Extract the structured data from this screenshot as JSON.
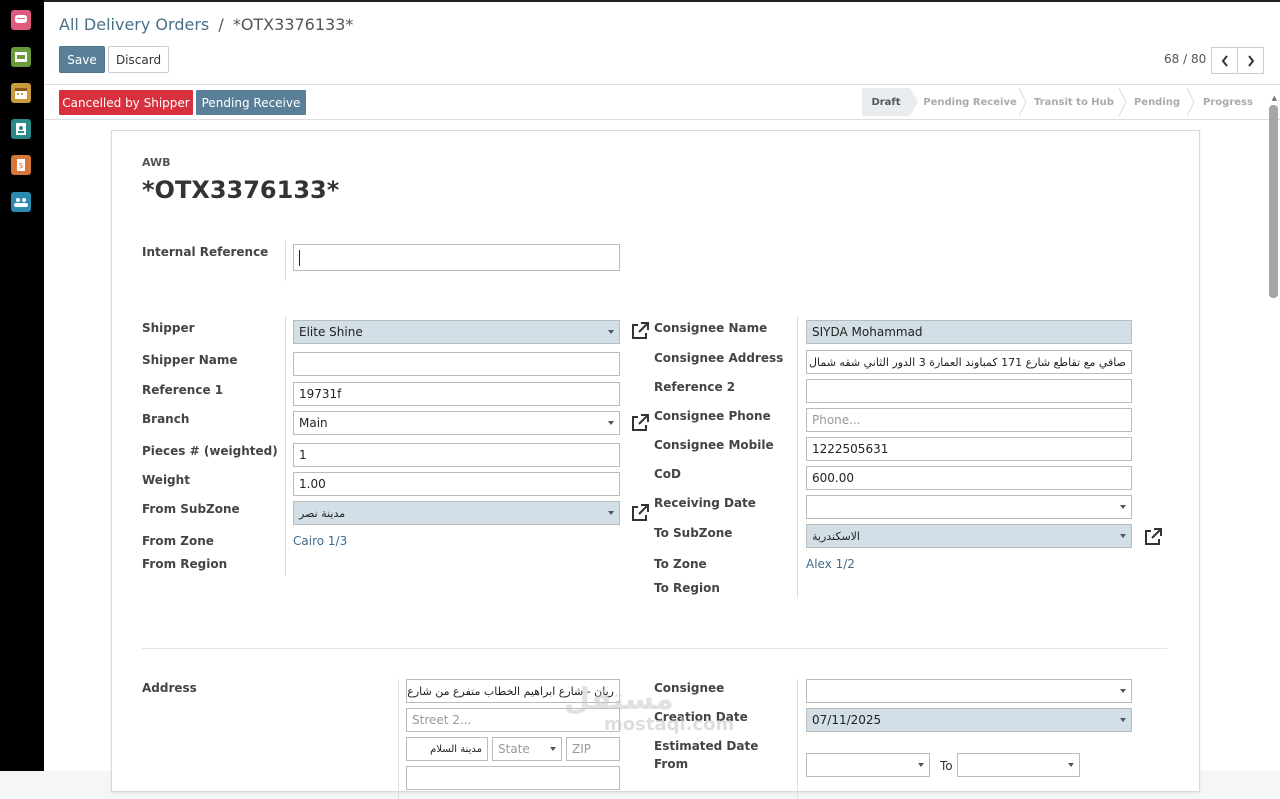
{
  "sidebar": {
    "apps": [
      {
        "icon": "discuss-icon",
        "color": "#e05c7f"
      },
      {
        "icon": "inventory-icon",
        "color": "#6a9a3a"
      },
      {
        "icon": "calendar-icon",
        "color": "#c89a3a"
      },
      {
        "icon": "contacts-icon",
        "color": "#2a8a8a"
      },
      {
        "icon": "invoicing-icon",
        "color": "#d9773a"
      },
      {
        "icon": "employees-icon",
        "color": "#2a8ab0"
      }
    ]
  },
  "breadcrumb": {
    "parent": "All Delivery Orders",
    "separator": "/",
    "current": "*OTX3376133*"
  },
  "toolbar": {
    "save_label": "Save",
    "discard_label": "Discard"
  },
  "pager": {
    "text": "68 / 80"
  },
  "status_buttons": {
    "cancel_label": "Cancelled by Shipper",
    "pending_label": "Pending Receive"
  },
  "stages": [
    "Draft",
    "Pending Receive",
    "Transit to Hub",
    "Pending",
    "Progress"
  ],
  "active_stage": "Draft",
  "colors": {
    "primary": "#5a7f99",
    "danger": "#d9303e",
    "required_bg": "#d2dfe6"
  },
  "form": {
    "awb_label": "AWB",
    "awb_value": "*OTX3376133*",
    "internal_reference": {
      "label": "Internal Reference",
      "value": ""
    },
    "left": {
      "shipper": {
        "label": "Shipper",
        "value": "Elite Shine"
      },
      "shipper_name": {
        "label": "Shipper Name",
        "value": ""
      },
      "reference1": {
        "label": "Reference 1",
        "value": "19731f"
      },
      "branch": {
        "label": "Branch",
        "value": "Main"
      },
      "pieces": {
        "label": "Pieces # (weighted)",
        "value": "1"
      },
      "weight": {
        "label": "Weight",
        "value": "1.00"
      },
      "from_subzone": {
        "label": "From SubZone",
        "value": "مدينة نصر"
      },
      "from_zone": {
        "label": "From Zone",
        "value": "Cairo 1/3"
      },
      "from_region": {
        "label": "From Region",
        "value": ""
      }
    },
    "right": {
      "consignee_name": {
        "label": "Consignee Name",
        "value": "SIYDA Mohammad"
      },
      "consignee_address": {
        "label": "Consignee Address",
        "value": "صافي مع تقاطع شارع 171 كمباوند العمارة 3 الدور الثاني شقه شمال الاسانسير"
      },
      "reference2": {
        "label": "Reference 2",
        "value": ""
      },
      "consignee_phone": {
        "label": "Consignee Phone",
        "placeholder": "Phone..."
      },
      "consignee_mobile": {
        "label": "Consignee Mobile",
        "value": "1222505631"
      },
      "cod": {
        "label": "CoD",
        "value": "600.00"
      },
      "receiving_date": {
        "label": "Receiving Date",
        "value": ""
      },
      "to_subzone": {
        "label": "To SubZone",
        "value": "الاسكندرية"
      },
      "to_zone": {
        "label": "To Zone",
        "value": "Alex 1/2"
      },
      "to_region": {
        "label": "To Region",
        "value": ""
      }
    },
    "address": {
      "label": "Address",
      "street": "ريان - شارع ابراهيم الخطاب متفرع من شارع الامل",
      "street2_placeholder": "Street 2...",
      "city": "مدينة السلام",
      "state_placeholder": "State",
      "zip_placeholder": "ZIP"
    },
    "bottom_right": {
      "consignee": {
        "label": "Consignee",
        "value": ""
      },
      "creation_date": {
        "label": "Creation Date",
        "value": "07/11/2025"
      },
      "estimated_date": {
        "label": "Estimated Date",
        "from_label": "From",
        "to_label": "To"
      }
    }
  },
  "watermark": {
    "arabic": "مستقل",
    "latin": "mostaql.com"
  }
}
